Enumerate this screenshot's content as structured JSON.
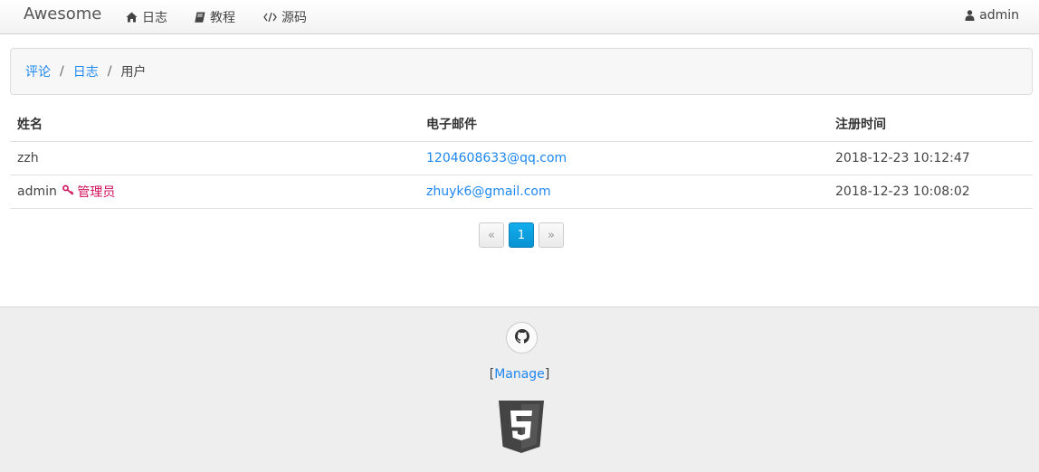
{
  "navbar": {
    "brand": "Awesome",
    "items": [
      {
        "label": "日志",
        "icon": "home-icon"
      },
      {
        "label": "教程",
        "icon": "book-icon"
      },
      {
        "label": "源码",
        "icon": "code-icon"
      }
    ],
    "user": {
      "label": "admin",
      "icon": "user-icon"
    }
  },
  "breadcrumb": {
    "items": [
      "评论",
      "日志"
    ],
    "separator": "/",
    "current": "用户"
  },
  "table": {
    "headers": [
      "姓名",
      "电子邮件",
      "注册时间"
    ],
    "rows": [
      {
        "name": "zzh",
        "badge": "",
        "email": "1204608633@qq.com",
        "registered": "2018-12-23 10:12:47"
      },
      {
        "name": "admin",
        "badge": "管理员",
        "email": "zhuyk6@gmail.com",
        "registered": "2018-12-23 10:08:02"
      }
    ]
  },
  "pagination": {
    "prev": "«",
    "current": "1",
    "next": "»"
  },
  "footer": {
    "manage_open": "[",
    "manage_label": "Manage",
    "manage_close": "]"
  },
  "colors": {
    "link": "#1e87f0",
    "admin_badge": "#d0105a",
    "active_page": "#0891d1"
  }
}
